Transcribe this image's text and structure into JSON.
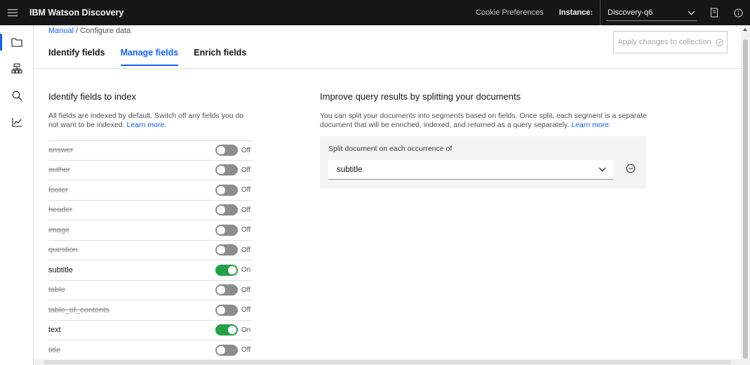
{
  "topbar": {
    "brand_prefix": "IBM",
    "brand_name": "Watson Discovery",
    "cookie_label": "Cookie Preferences",
    "instance_label": "Instance:",
    "instance_value": "Discovery-q6"
  },
  "breadcrumb": {
    "parent": "Manual",
    "separator": "/",
    "current": "Configure data"
  },
  "tabs": [
    {
      "label": "Identify fields",
      "selected": false
    },
    {
      "label": "Manage fields",
      "selected": true
    },
    {
      "label": "Enrich fields",
      "selected": false
    }
  ],
  "apply_button": {
    "label": "Apply changes to collection"
  },
  "index_section": {
    "title": "Identify fields to index",
    "description": "All fields are indexed by default. Switch off any fields you do not want to be indexed.",
    "link": "Learn more."
  },
  "fields": [
    {
      "name": "answer",
      "state": "Off"
    },
    {
      "name": "author",
      "state": "Off"
    },
    {
      "name": "footer",
      "state": "Off"
    },
    {
      "name": "header",
      "state": "Off"
    },
    {
      "name": "image",
      "state": "Off"
    },
    {
      "name": "question",
      "state": "Off"
    },
    {
      "name": "subtitle",
      "state": "On"
    },
    {
      "name": "table",
      "state": "Off"
    },
    {
      "name": "table_of_contents",
      "state": "Off"
    },
    {
      "name": "text",
      "state": "On"
    },
    {
      "name": "title",
      "state": "Off"
    }
  ],
  "split_section": {
    "title": "Improve query results by splitting your documents",
    "description": "You can split your documents into segments based on fields. Once split, each segment is a separate document that will be enriched, indexed, and returned as a query separately.",
    "link": "Learn more.",
    "select_label": "Split document on each occurrence of",
    "select_value": "subtitle"
  },
  "colors": {
    "accent": "#0f62fe",
    "toggle_on": "#24a148",
    "toggle_off": "#8d8d8d",
    "topbar_bg": "#161616"
  }
}
